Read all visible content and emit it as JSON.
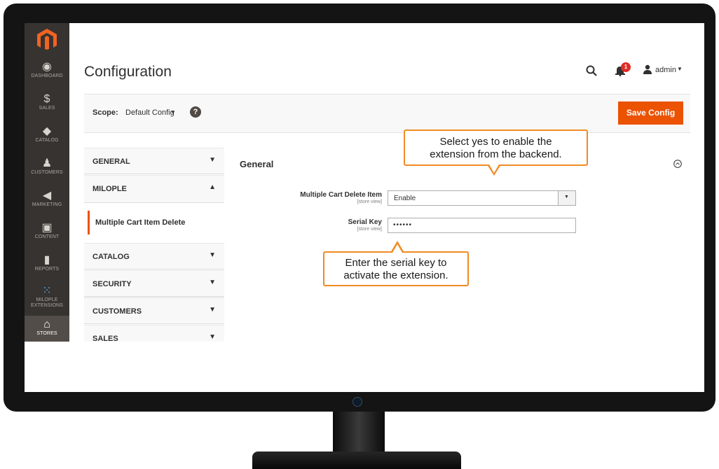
{
  "colors": {
    "accent": "#eb5202",
    "sidebar": "#373330",
    "callout_border": "#f08a24",
    "badge": "#e02b27"
  },
  "sidebar": {
    "logo": "magento-logo",
    "items": [
      {
        "label": "DASHBOARD",
        "icon": "dashboard-icon",
        "glyph": "◉"
      },
      {
        "label": "SALES",
        "icon": "dollar-icon",
        "glyph": "$"
      },
      {
        "label": "CATALOG",
        "icon": "cube-icon",
        "glyph": "◆"
      },
      {
        "label": "CUSTOMERS",
        "icon": "person-icon",
        "glyph": "♟"
      },
      {
        "label": "MARKETING",
        "icon": "megaphone-icon",
        "glyph": "◀"
      },
      {
        "label": "CONTENT",
        "icon": "layout-icon",
        "glyph": "▣"
      },
      {
        "label": "REPORTS",
        "icon": "bar-chart-icon",
        "glyph": "▮"
      },
      {
        "label_line1": "MILOPLE",
        "label_line2": "EXTENSIONS",
        "icon": "grid-dots-icon",
        "glyph": "⁙"
      },
      {
        "label": "STORES",
        "icon": "store-icon",
        "glyph": "⌂"
      }
    ]
  },
  "header": {
    "title": "Configuration",
    "notification_count": "1",
    "user_label": "admin",
    "caret": "▼"
  },
  "scope": {
    "label": "Scope:",
    "value": "Default Config",
    "caret": "▼",
    "help_glyph": "?",
    "save_label": "Save Config"
  },
  "tabs": [
    {
      "label": "GENERAL",
      "chevron": "▼"
    },
    {
      "label": "MILOPLE",
      "chevron": "▲"
    },
    {
      "label": "CATALOG",
      "chevron": "▼"
    },
    {
      "label": "SECURITY",
      "chevron": "▼"
    },
    {
      "label": "CUSTOMERS",
      "chevron": "▼"
    },
    {
      "label": "SALES",
      "chevron": "▼"
    }
  ],
  "subtab": {
    "label": "Multiple Cart Item Delete"
  },
  "section": {
    "title": "General",
    "fields": [
      {
        "label": "Multiple Cart Delete Item",
        "scope": "[store view]",
        "value": "Enable",
        "type": "select"
      },
      {
        "label": "Serial Key",
        "scope": "[store view]",
        "value": "••••••",
        "type": "password"
      }
    ]
  },
  "callouts": {
    "top_line1": "Select yes to enable the",
    "top_line2": "extension from the backend.",
    "bottom_line1": "Enter the serial key to",
    "bottom_line2": "activate the extension."
  }
}
